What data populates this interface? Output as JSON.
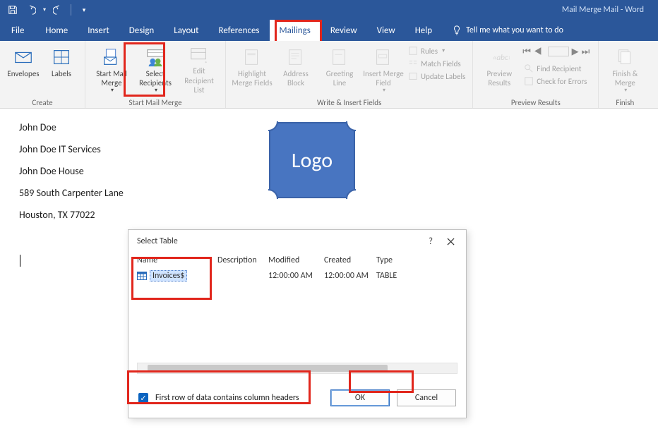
{
  "title_bar": {
    "app_title": "Mail Merge Mail  -  Word"
  },
  "qat": {
    "save_tip": "Save",
    "undo_tip": "Undo",
    "redo_tip": "Redo"
  },
  "tabs": {
    "file": "File",
    "home": "Home",
    "insert": "Insert",
    "design": "Design",
    "layout": "Layout",
    "references": "References",
    "mailings": "Mailings",
    "review": "Review",
    "view": "View",
    "help": "Help",
    "tell_me": "Tell me what you want to do"
  },
  "ribbon": {
    "create": {
      "label": "Create",
      "envelopes": "Envelopes",
      "labels": "Labels"
    },
    "start_merge": {
      "label": "Start Mail Merge",
      "start_mail_merge": "Start Mail\nMerge",
      "select_recipients": "Select\nRecipients",
      "edit_recipient_list": "Edit\nRecipient List"
    },
    "write_insert": {
      "label": "Write & Insert Fields",
      "highlight_merge_fields": "Highlight\nMerge Fields",
      "address_block": "Address\nBlock",
      "greeting_line": "Greeting\nLine",
      "insert_merge_field": "Insert Merge\nField",
      "rules": "Rules",
      "match_fields": "Match Fields",
      "update_labels": "Update Labels"
    },
    "preview": {
      "label": "Preview Results",
      "preview_results": "Preview\nResults",
      "find_recipient": "Find Recipient",
      "check_errors": "Check for Errors"
    },
    "finish": {
      "label": "Finish",
      "finish_merge": "Finish &\nMerge"
    }
  },
  "document": {
    "lines": [
      "John Doe",
      "John Doe IT Services",
      "John Doe House",
      "589 South Carpenter Lane",
      "Houston, TX 77022"
    ],
    "logo_text": "Logo"
  },
  "dialog": {
    "title": "Select Table",
    "help_glyph": "?",
    "close_glyph": "✕",
    "columns": {
      "name": "Name",
      "description": "Description",
      "modified": "Modified",
      "created": "Created",
      "type": "Type"
    },
    "rows": [
      {
        "name": "Invoices$",
        "description": "",
        "modified": "12:00:00 AM",
        "created": "12:00:00 AM",
        "type": "TABLE"
      }
    ],
    "checkbox_label": "First row of data contains column headers",
    "checkbox_checked": true,
    "ok": "OK",
    "cancel": "Cancel"
  }
}
